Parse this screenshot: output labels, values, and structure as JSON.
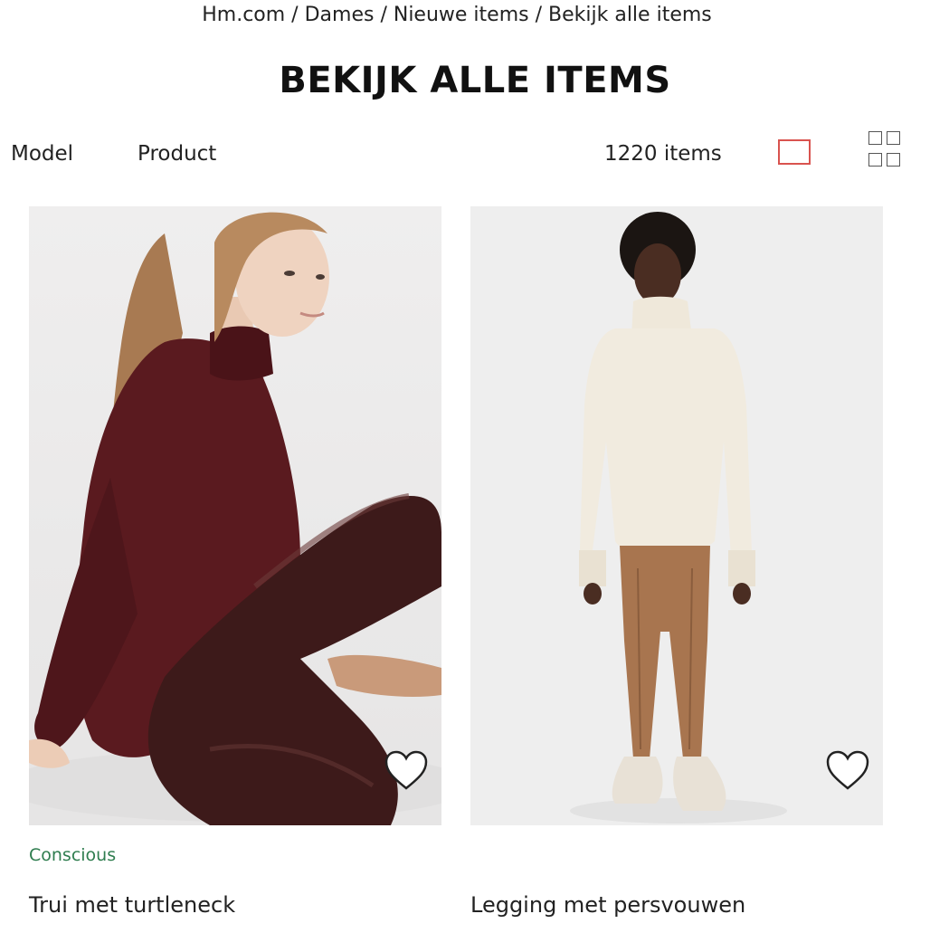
{
  "breadcrumb": {
    "items": [
      "Hm.com",
      "Dames",
      "Nieuwe items",
      "Bekijk alle items"
    ],
    "separator": " / "
  },
  "page": {
    "title": "BEKIJK ALLE ITEMS"
  },
  "filters": {
    "model_label": "Model",
    "product_label": "Product",
    "item_count": "1220 items",
    "active_view": "single",
    "active_view_color": "#d9534f"
  },
  "products": [
    {
      "badge": "Conscious",
      "badge_color": "#2f7d4f",
      "name": "Trui met turtleneck",
      "favorite_icon": "heart-outline-icon"
    },
    {
      "badge": "",
      "name": "Legging met persvouwen",
      "favorite_icon": "heart-outline-icon"
    }
  ]
}
